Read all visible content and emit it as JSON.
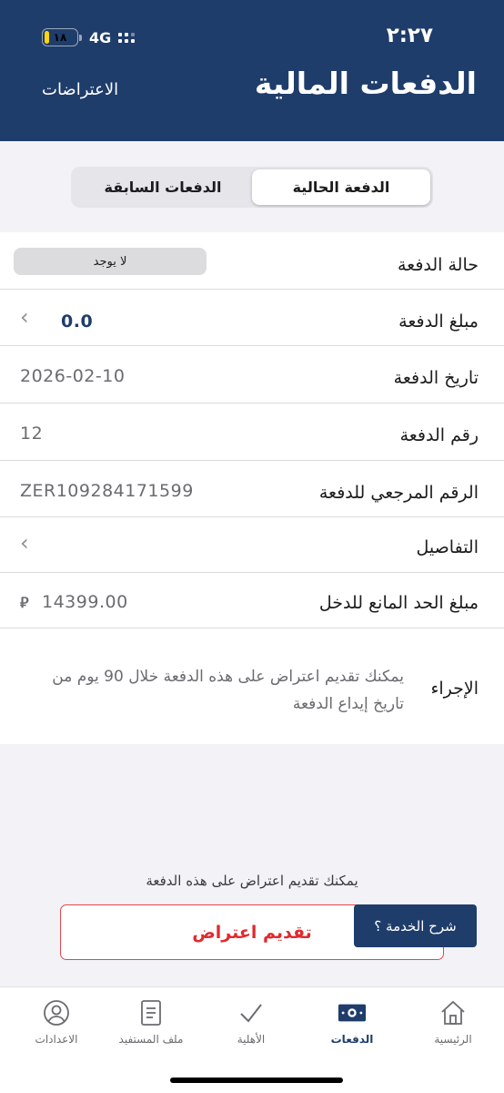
{
  "status_bar": {
    "time": "٢:٢٧",
    "battery": "١٨",
    "battery_level": 0.18,
    "network": "4G"
  },
  "header": {
    "title": "الدفعات المالية",
    "objections_link": "الاعتراضات"
  },
  "segments": {
    "current": "الدفعة الحالية",
    "previous": "الدفعات السابقة"
  },
  "details": {
    "status": {
      "label": "حالة الدفعة",
      "value": "لا يوجد"
    },
    "amount": {
      "label": "مبلغ الدفعة",
      "value": "0.0"
    },
    "date": {
      "label": "تاريخ الدفعة",
      "value": "2026-02-10"
    },
    "number": {
      "label": "رقم الدفعة",
      "value": "12"
    },
    "reference": {
      "label": "الرقم المرجعي للدفعة",
      "value": "ZER109284171599"
    },
    "details_row": {
      "label": "التفاصيل"
    },
    "income_cap": {
      "label": "مبلغ الحد المانع للدخل",
      "value": "14399.00",
      "currency": "⃁"
    },
    "action": {
      "label": "الإجراء",
      "value": "يمكنك تقديم اعتراض على هذه الدفعة خلال 90 يوم من تاريخ إيداع الدفعة"
    }
  },
  "footer": {
    "hint": "يمكنك تقديم اعتراض على هذه الدفعة",
    "objection_button": "تقديم اعتراض",
    "explain_button": "شرح الخدمة ؟"
  },
  "tabbar": {
    "home": "الرئيسية",
    "payments": "الدفعات",
    "eligibility": "الأهلية",
    "beneficiary": "ملف المستفيد",
    "settings": "الاعدادات"
  },
  "colors": {
    "primary": "#1f3d6b",
    "danger": "#e02a2f",
    "battery": "#ffd60a"
  }
}
